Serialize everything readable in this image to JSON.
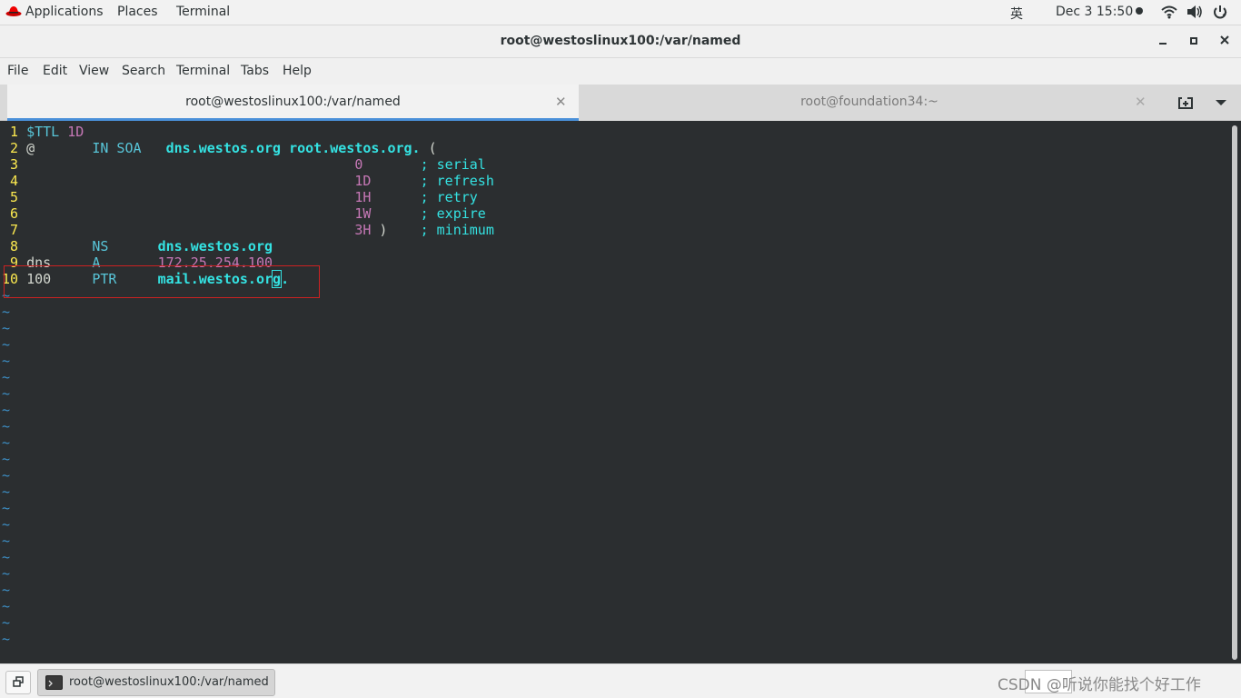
{
  "topbar": {
    "applications": "Applications",
    "places": "Places",
    "terminal": "Terminal",
    "input_method": "英",
    "clock": "Dec 3  15:50",
    "icons": [
      "redhat-icon",
      "wifi-icon",
      "volume-icon",
      "power-icon"
    ]
  },
  "window": {
    "title": "root@westoslinux100:/var/named",
    "buttons": [
      "minimize",
      "maximize",
      "close"
    ]
  },
  "menubar": {
    "items": [
      "File",
      "Edit",
      "View",
      "Search",
      "Terminal",
      "Tabs",
      "Help"
    ]
  },
  "tabs": [
    {
      "label": "root@westoslinux100:/var/named",
      "active": true
    },
    {
      "label": "root@foundation34:~",
      "active": false
    }
  ],
  "vim": {
    "lines": [
      {
        "num": " 1",
        "parts": [
          {
            "t": "$TTL",
            "c": "k"
          },
          {
            "t": " "
          },
          {
            "t": "1D",
            "c": "n"
          }
        ]
      },
      {
        "num": " 2",
        "parts": [
          {
            "t": "@       "
          },
          {
            "t": "IN SOA",
            "c": "k"
          },
          {
            "t": "   "
          },
          {
            "t": "dns.westos.org root.westos.org.",
            "c": "b"
          },
          {
            "t": " ("
          }
        ]
      },
      {
        "num": " 3",
        "parts": [
          {
            "t": "                                        "
          },
          {
            "t": "0",
            "c": "n"
          },
          {
            "t": "       "
          },
          {
            "t": "; serial",
            "c": "c"
          }
        ]
      },
      {
        "num": " 4",
        "parts": [
          {
            "t": "                                        "
          },
          {
            "t": "1D",
            "c": "n"
          },
          {
            "t": "      "
          },
          {
            "t": "; refresh",
            "c": "c"
          }
        ]
      },
      {
        "num": " 5",
        "parts": [
          {
            "t": "                                        "
          },
          {
            "t": "1H",
            "c": "n"
          },
          {
            "t": "      "
          },
          {
            "t": "; retry",
            "c": "c"
          }
        ]
      },
      {
        "num": " 6",
        "parts": [
          {
            "t": "                                        "
          },
          {
            "t": "1W",
            "c": "n"
          },
          {
            "t": "      "
          },
          {
            "t": "; expire",
            "c": "c"
          }
        ]
      },
      {
        "num": " 7",
        "parts": [
          {
            "t": "                                        "
          },
          {
            "t": "3H",
            "c": "n"
          },
          {
            "t": " )    "
          },
          {
            "t": "; minimum",
            "c": "c"
          }
        ]
      },
      {
        "num": " 8",
        "parts": [
          {
            "t": "        "
          },
          {
            "t": "NS",
            "c": "k"
          },
          {
            "t": "      "
          },
          {
            "t": "dns.westos.org",
            "c": "b"
          }
        ]
      },
      {
        "num": " 9",
        "parts": [
          {
            "t": "dns     "
          },
          {
            "t": "A",
            "c": "k"
          },
          {
            "t": "       "
          },
          {
            "t": "172.25.254.100",
            "c": "n"
          }
        ]
      },
      {
        "num": "10",
        "parts": [
          {
            "t": "100     "
          },
          {
            "t": "PTR",
            "c": "k"
          },
          {
            "t": "     "
          },
          {
            "t": "mail.westos.or",
            "c": "b"
          },
          {
            "t": "g",
            "c": "b cur"
          },
          {
            "t": ".",
            "c": "b"
          }
        ]
      }
    ],
    "tilde": "~",
    "tilde_count": 22
  },
  "taskbar": {
    "task_label": "root@westoslinux100:/var/named",
    "watermark": "CSDN @听说你能找个好工作"
  }
}
